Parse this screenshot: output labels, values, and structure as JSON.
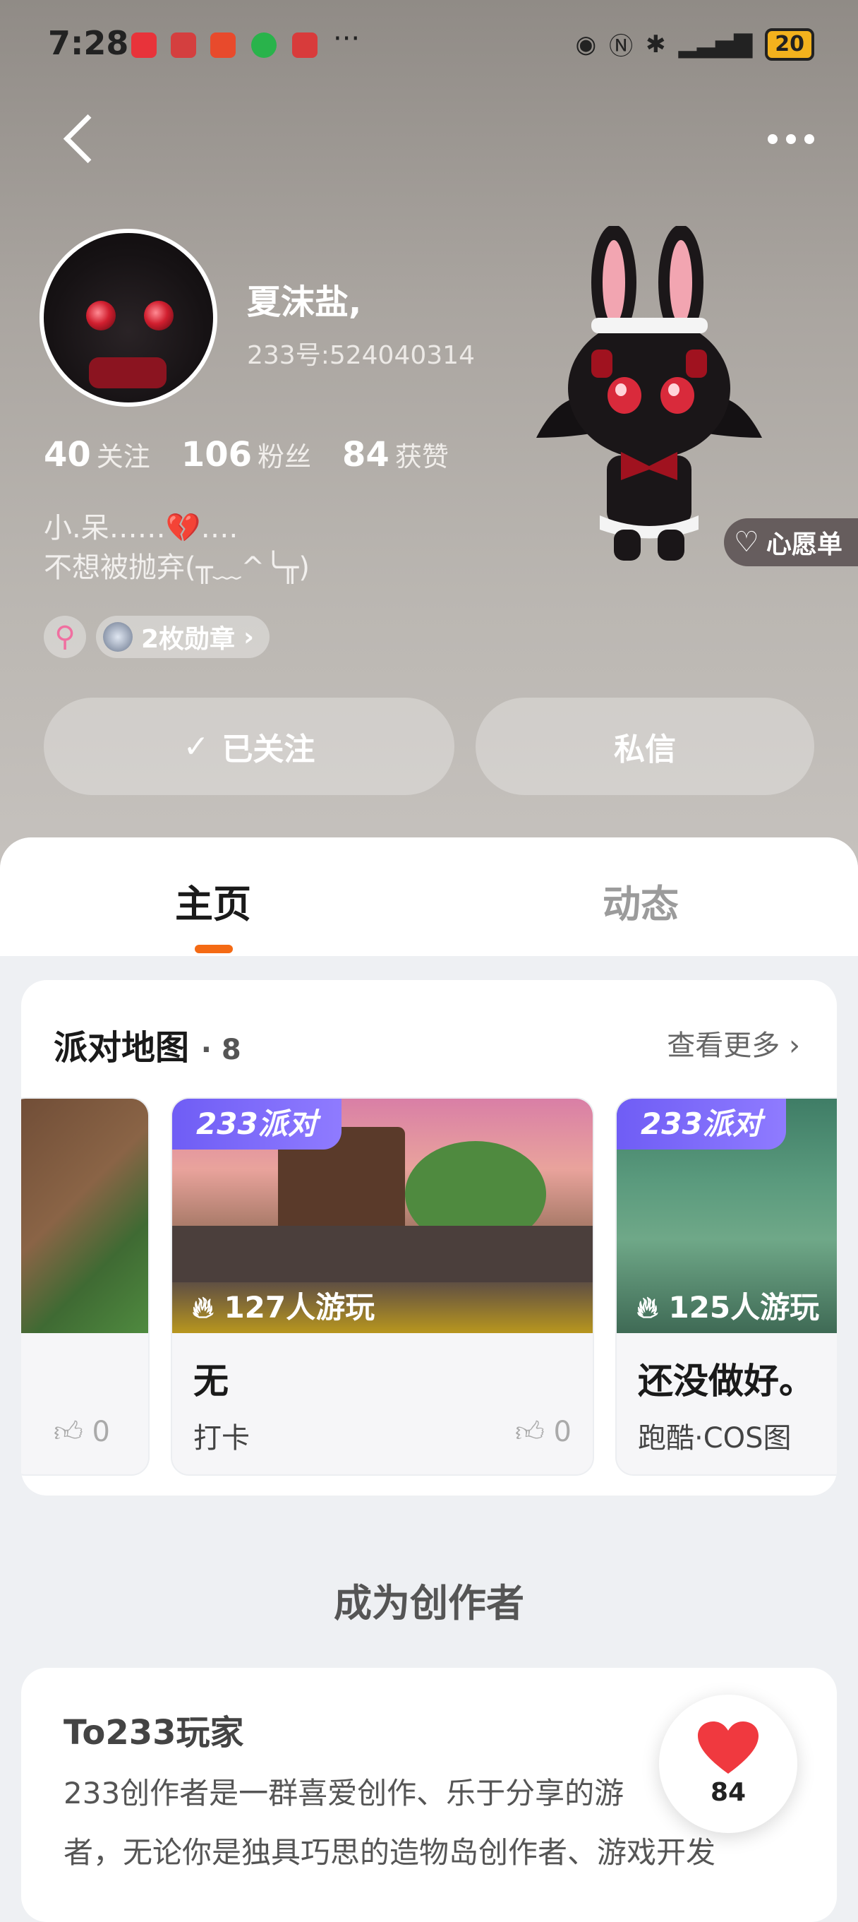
{
  "status_bar": {
    "time": "7:28",
    "battery": "20",
    "more": "···"
  },
  "profile": {
    "name": "夏沫盐,",
    "uid": "233号:524040314",
    "stats": [
      {
        "value": "40",
        "label": "关注"
      },
      {
        "value": "106",
        "label": "粉丝"
      },
      {
        "value": "84",
        "label": "获赞"
      }
    ],
    "bio_line1": "小.呆……💔….",
    "bio_line2": "不想被抛弃(╥﹏^╰╥)",
    "gender_symbol": "⚲",
    "medals": "2枚勋章",
    "wishlist": "心愿单"
  },
  "actions": {
    "followed": "已关注",
    "message": "私信"
  },
  "tabs": {
    "home": "主页",
    "feed": "动态"
  },
  "party_maps": {
    "title": "派对地图",
    "count": "· 8",
    "see_more": "查看更多",
    "cards": [
      {
        "like": "0"
      },
      {
        "tag": "233派对",
        "plays": "127人游玩",
        "title": "无",
        "subtitle": "打卡",
        "like": "0"
      },
      {
        "tag": "233派对",
        "plays": "125人游玩",
        "title": "还没做好。",
        "subtitle": "跑酷·COS图"
      }
    ]
  },
  "creator": {
    "heading": "成为创作者",
    "card_title": "To233玩家",
    "body_line1": "233创作者是一群喜爱创作、乐于分享的游",
    "body_line2": "者，无论你是独具巧思的造物岛创作者、游戏开发"
  },
  "like_fab": {
    "count": "84"
  },
  "colors": {
    "accent": "#f46a14",
    "tag_purple": "#7a66f8"
  }
}
